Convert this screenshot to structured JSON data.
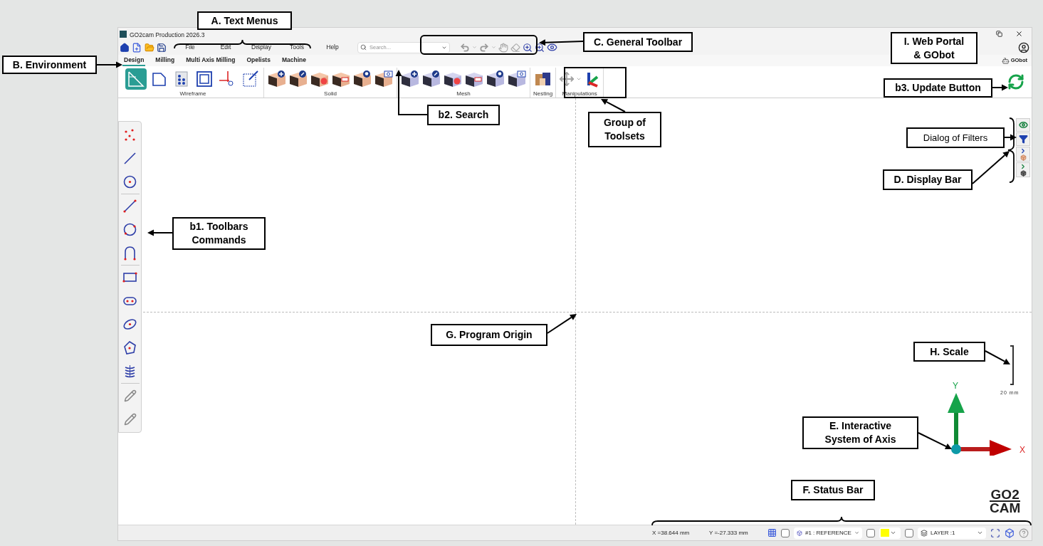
{
  "window": {
    "title": "GO2cam Production 2026.3"
  },
  "menus": [
    "File",
    "Edit",
    "Display",
    "Tools",
    "Help"
  ],
  "search": {
    "placeholder": "Search..."
  },
  "environment_tabs": [
    {
      "label": "Design",
      "selected": true
    },
    {
      "label": "Milling",
      "selected": false
    },
    {
      "label": "Multi Axis Milling",
      "selected": false
    },
    {
      "label": "Opelists",
      "selected": false
    },
    {
      "label": "Machine",
      "selected": false
    }
  ],
  "gobot": {
    "label": "GObot"
  },
  "ribbon": {
    "groups": [
      {
        "label": "Wireframe",
        "tools": [
          {
            "selected": true
          },
          {
            "selected": false
          },
          {
            "selected": false
          },
          {
            "selected": false
          },
          {
            "selected": false
          },
          {
            "selected": false
          }
        ]
      },
      {
        "label": "Solid"
      },
      {
        "label": "Mesh"
      },
      {
        "label": "Nesting"
      },
      {
        "label": "Manipulations"
      }
    ]
  },
  "scale": {
    "label": "20 mm"
  },
  "axes": {
    "y_label": "Y",
    "x_label": "X"
  },
  "logo": {
    "lines": [
      "GO2",
      "CAM"
    ]
  },
  "status_bar": {
    "x": "X =38.644 mm",
    "y": "Y =-27.333 mm",
    "reference": "#1 : REFERENCE",
    "reference_checked": false,
    "color_checked": false,
    "color": "#ffff00",
    "layer_checked": false,
    "layer": "LAYER :1"
  },
  "callouts": [
    {
      "text": "A. Text Menus",
      "bold": true
    },
    {
      "text": "B. Environment",
      "bold": true
    },
    {
      "text": "C. General Toolbar",
      "bold": true
    },
    {
      "text": "I. Web Portal & GObot",
      "bold": true
    },
    {
      "text": "b3. Update Button",
      "bold": true
    },
    {
      "text": "b2. Search",
      "bold": true
    },
    {
      "text": "Group of Toolsets",
      "bold": true
    },
    {
      "text": "Dialog of Filters",
      "bold": false
    },
    {
      "text": "D. Display Bar",
      "bold": true
    },
    {
      "text": "b1. Toolbars Commands",
      "bold": true
    },
    {
      "text": "G. Program Origin",
      "bold": true
    },
    {
      "text": "H. Scale",
      "bold": true
    },
    {
      "text": "E. Interactive System of Axis",
      "bold": true
    },
    {
      "text": "F. Status Bar",
      "bold": true
    }
  ]
}
